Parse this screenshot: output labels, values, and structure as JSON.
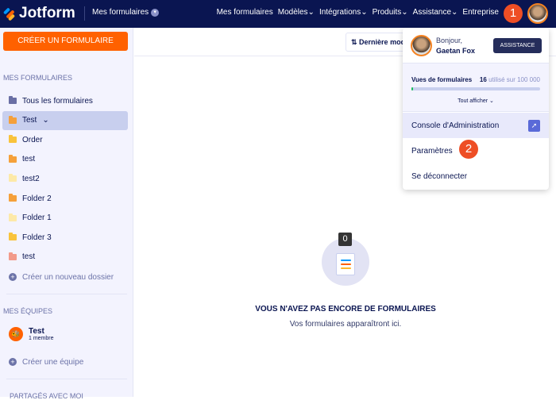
{
  "header": {
    "logo": "Jotform",
    "my_forms": "Mes formulaires",
    "nav": [
      "Mes formulaires",
      "Modèles",
      "Intégrations",
      "Produits",
      "Assistance",
      "Entreprise"
    ],
    "step1": "1"
  },
  "sidebar": {
    "create_button": "CRÉER UN FORMULAIRE",
    "forms_section": "MES FORMULAIRES",
    "folders": [
      {
        "label": "Tous les formulaires",
        "color": "#6a6fa5"
      },
      {
        "label": "Test",
        "color": "#f5a03a"
      },
      {
        "label": "Order",
        "color": "#f9c33c"
      },
      {
        "label": "test",
        "color": "#f5a03a"
      },
      {
        "label": "test2",
        "color": "#fde9a8"
      },
      {
        "label": "Folder 2",
        "color": "#f5a03a"
      },
      {
        "label": "Folder 1",
        "color": "#fde9a8"
      },
      {
        "label": "Folder 3",
        "color": "#f9c33c"
      },
      {
        "label": "test",
        "color": "#f29a8a"
      }
    ],
    "new_folder": "Créer un nouveau dossier",
    "teams_section": "MES ÉQUIPES",
    "team": {
      "name": "Test",
      "members": "1 membre"
    },
    "new_team": "Créer une équipe",
    "shared_section": "PARTAGÉS AVEC MOI"
  },
  "main": {
    "sort_label": "Dernière modification",
    "count": "0",
    "empty_title": "VOUS N'AVEZ PAS ENCORE DE FORMULAIRES",
    "empty_sub": "Vos formulaires apparaîtront ici."
  },
  "dropdown": {
    "greeting": "Bonjour,",
    "user": "Gaetan Fox",
    "assist_button": "ASSISTANCE",
    "usage_label": "Vues de formulaires",
    "usage_used": "16",
    "usage_rest": "utilisé sur 100 000",
    "usage_fraction": 0.00016,
    "show_all": "Tout afficher",
    "admin": "Console d'Administration",
    "settings": "Paramètres",
    "logout": "Se déconnecter",
    "step2": "2"
  }
}
